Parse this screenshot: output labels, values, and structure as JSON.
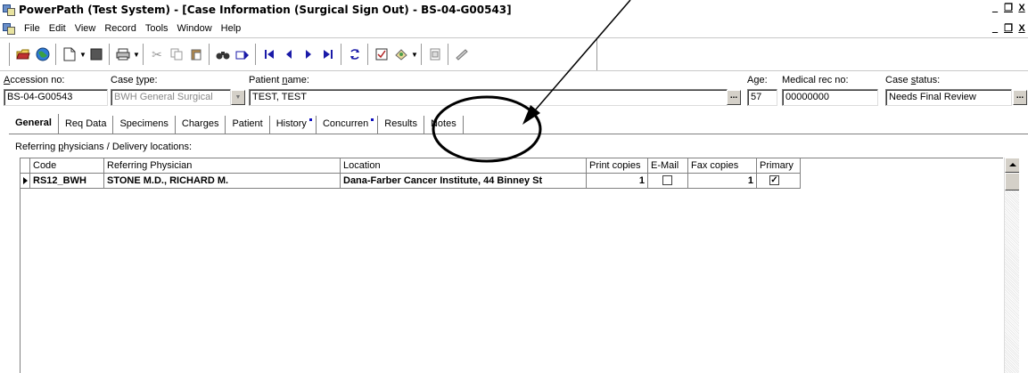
{
  "window": {
    "title": "PowerPath (Test System) - [Case Information (Surgical Sign Out) - BS-04-G00543]",
    "controls": [
      "_",
      "Ő",
      "X"
    ]
  },
  "menu": {
    "items": [
      "File",
      "Edit",
      "View",
      "Record",
      "Tools",
      "Window",
      "Help"
    ]
  },
  "toolbar": {
    "icons": [
      "open-folder-icon",
      "globe-icon",
      "new-document-icon",
      "save-icon",
      "print-icon",
      "cut-icon",
      "copy-icon",
      "paste-icon",
      "binoculars-icon",
      "find-next-icon",
      "first-record-icon",
      "previous-record-icon",
      "next-record-icon",
      "last-record-icon",
      "refresh-icon",
      "checklist-icon",
      "stamp-icon",
      "copy-page-icon",
      "edit-icon"
    ]
  },
  "case": {
    "accession_label": "Accession no:",
    "accession_value": "BS-04-G00543",
    "case_type_label": "Case type:",
    "case_type_value": "BWH General Surgical",
    "patient_name_label": "Patient name:",
    "patient_name_value": "TEST, TEST",
    "age_label": "Age:",
    "age_value": "57",
    "mrn_label": "Medical rec no:",
    "mrn_value": "00000000",
    "status_label": "Case status:",
    "status_value": "Needs Final Review",
    "ellipsis": "..."
  },
  "tabs": [
    {
      "label": "General",
      "active": true
    },
    {
      "label": "Req Data"
    },
    {
      "label": "Specimens"
    },
    {
      "label": "Charges"
    },
    {
      "label": "Patient"
    },
    {
      "label": "History",
      "marker": true
    },
    {
      "label": "Concurren",
      "marker": true
    },
    {
      "label": "Results"
    },
    {
      "label": "Notes"
    }
  ],
  "physicians": {
    "section_label": "Referring physicians / Delivery locations:",
    "columns": [
      "Code",
      "Referring Physician",
      "Location",
      "Print copies",
      "E-Mail",
      "Fax copies",
      "Primary"
    ],
    "rows": [
      {
        "code": "RS12_BWH",
        "physician": "STONE M.D., RICHARD M.",
        "location": "Dana-Farber Cancer Institute, 44 Binney St",
        "print_copies": "1",
        "email": false,
        "fax_copies": "1",
        "primary": true
      }
    ]
  },
  "annotation": {
    "color": "#000000"
  }
}
